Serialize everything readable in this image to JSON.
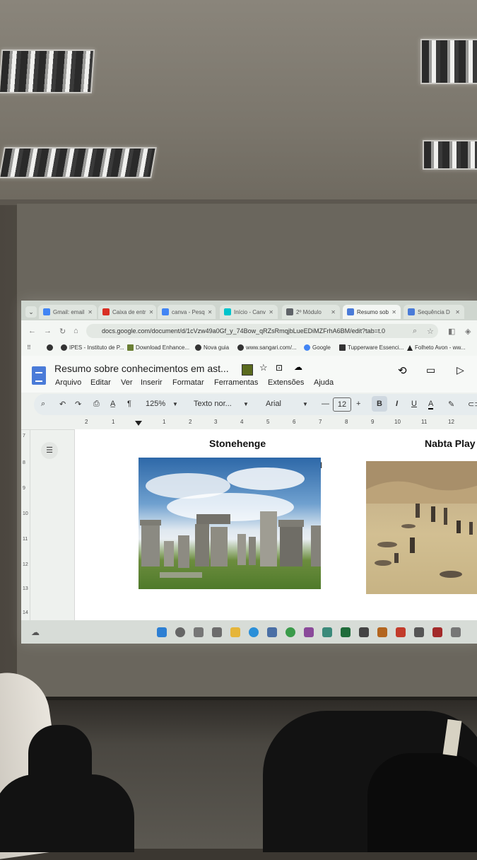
{
  "browser": {
    "tabs": [
      {
        "label": "Gmail: email"
      },
      {
        "label": "Caixa de entr"
      },
      {
        "label": "canva - Pesq"
      },
      {
        "label": "Início - Canv"
      },
      {
        "label": "2º Módulo"
      },
      {
        "label": "Resumo sob"
      },
      {
        "label": "Sequência D"
      }
    ],
    "url": "docs.google.com/document/d/1cVzw49a0Gf_y_74Bow_qRZsRmqjbLueEDiMZFrhA6BM/edit?tab=t.0",
    "bookmarks": [
      "IPES - Instituto de P...",
      "Download Enhance...",
      "Nova guia",
      "www.sangari.com/...",
      "Google",
      "Tupperware Essenci...",
      "Folheto Avon - ww..."
    ]
  },
  "doc": {
    "title": "Resumo sobre conhecimentos em ast...",
    "menu": [
      "Arquivo",
      "Editar",
      "Ver",
      "Inserir",
      "Formatar",
      "Ferramentas",
      "Extensões",
      "Ajuda"
    ],
    "toolbar": {
      "zoom": "125%",
      "style": "Texto nor...",
      "font": "Arial",
      "font_size": "12"
    },
    "ruler_numbers": [
      "2",
      "1",
      "1",
      "2",
      "3",
      "4",
      "5",
      "6",
      "7",
      "8",
      "9",
      "10",
      "11",
      "12"
    ],
    "vruler_numbers": [
      "7",
      "8",
      "9",
      "10",
      "11",
      "12",
      "13",
      "14"
    ],
    "images": [
      {
        "caption": "Stonehenge"
      },
      {
        "caption": "Nabta Play"
      }
    ]
  },
  "colors": {
    "docs_blue": "#4a7bd8",
    "toolbar_bg": "#e6ecee"
  }
}
